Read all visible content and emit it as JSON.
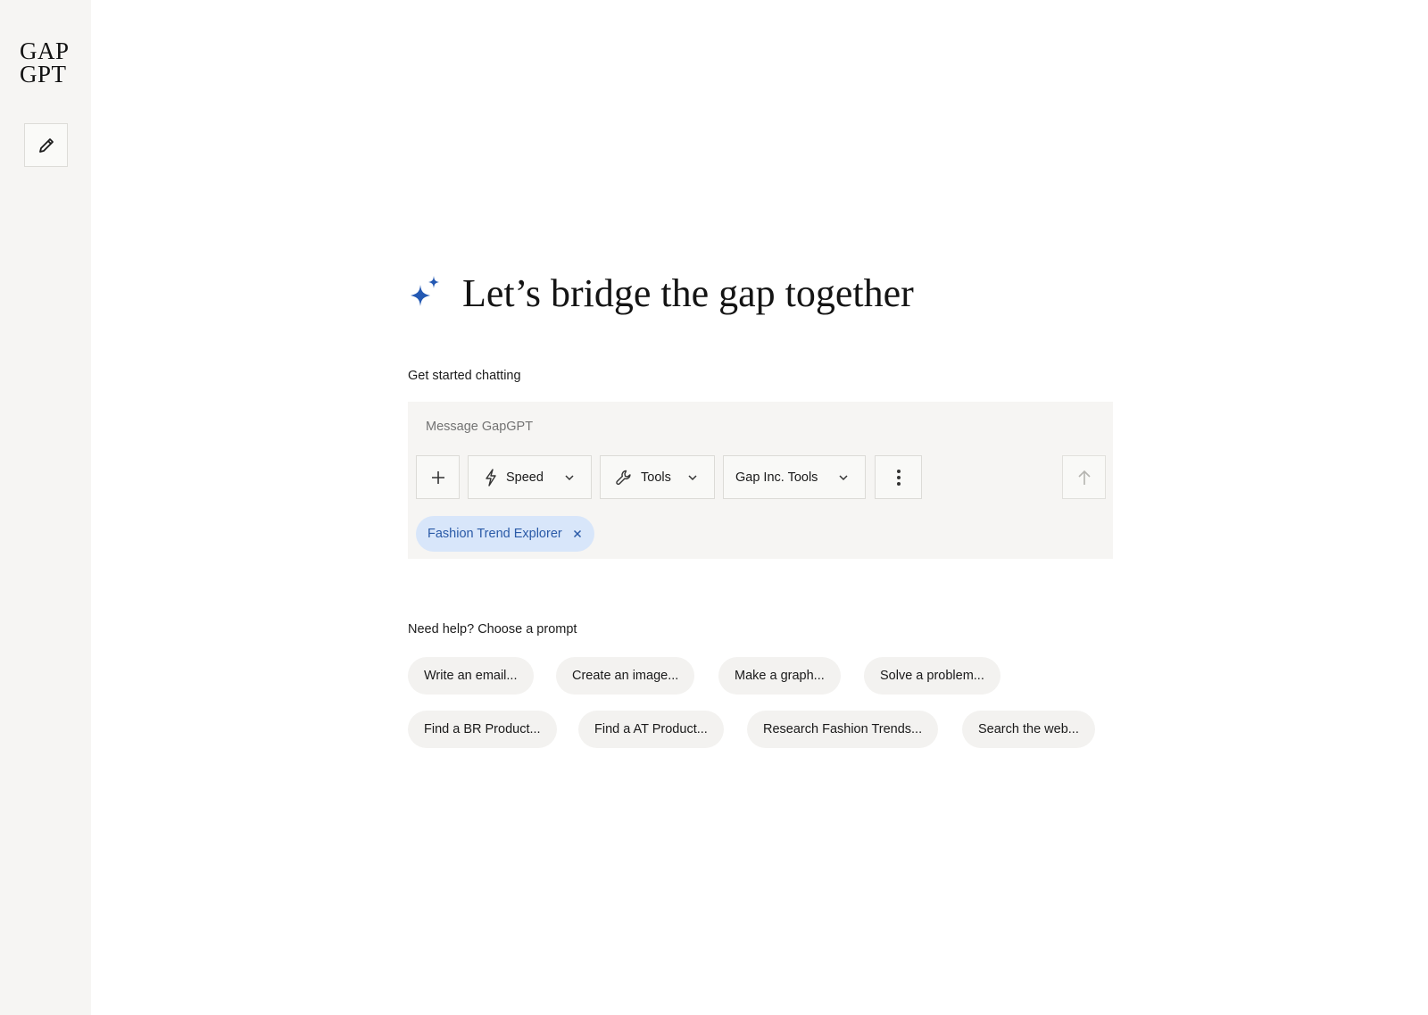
{
  "sidebar": {
    "logo_line1": "GAP",
    "logo_line2": "GPT",
    "new_chat_icon": "pencil-icon"
  },
  "hero": {
    "title": "Let’s bridge the gap together",
    "icon": "sparkle-icon",
    "icon_color": "#2459b3"
  },
  "composer": {
    "section_label": "Get started chatting",
    "placeholder": "Message GapGPT",
    "value": "",
    "buttons": {
      "add_icon": "plus-icon",
      "speed_label": "Speed",
      "tools_label": "Tools",
      "gap_tools_label": "Gap Inc. Tools",
      "more_icon": "vertical-dots-icon",
      "send_icon": "arrow-up-icon"
    },
    "chip": {
      "label": "Fashion Trend Explorer",
      "bg_color": "#d8e6fa",
      "text_color": "#2a5aa7"
    }
  },
  "prompts": {
    "section_label": "Need help? Choose a prompt",
    "items": [
      "Write an email...",
      "Create an image...",
      "Make a graph...",
      "Solve a problem...",
      "Find a BR Product...",
      "Find a AT Product...",
      "Research Fashion Trends...",
      "Search the web..."
    ]
  }
}
